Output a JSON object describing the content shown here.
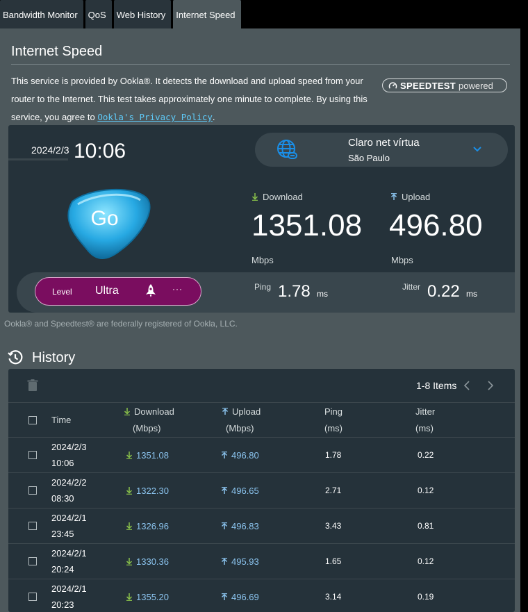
{
  "tabs": [
    {
      "label": "Bandwidth Monitor",
      "active": false
    },
    {
      "label": "QoS",
      "active": false
    },
    {
      "label": "Web History",
      "active": false
    },
    {
      "label": "Internet Speed",
      "active": true
    }
  ],
  "page": {
    "title": "Internet Speed",
    "description": "This service is provided by Ookla®. It detects the download and upload speed from your router to the Internet. This test takes approximately one minute to complete. By using this service, you agree to",
    "privacy_link": "Ookla's Privacy Policy",
    "description_end": ".",
    "logo_name": "SPEEDTEST",
    "logo_powered": "powered"
  },
  "result": {
    "date": "2024/2/3",
    "time": "10:06",
    "server_name": "Claro net vírtua",
    "server_location": "São Paulo",
    "go_label": "Go",
    "download_label": "Download",
    "upload_label": "Upload",
    "download_value": "1351.08",
    "upload_value": "496.80",
    "download_unit": "Mbps",
    "upload_unit": "Mbps",
    "level_label": "Level",
    "level_value": "Ultra",
    "more_label": "···",
    "ping_label": "Ping",
    "ping_value": "1.78",
    "ping_unit": "ms",
    "jitter_label": "Jitter",
    "jitter_value": "0.22",
    "jitter_unit": "ms"
  },
  "ookla_note": "Ookla® and Speedtest® are federally registered of Ookla, LLC.",
  "history": {
    "title": "History",
    "pager": "1-8 Items",
    "columns": {
      "time": "Time",
      "download": "Download",
      "download_unit": "(Mbps)",
      "upload": "Upload",
      "upload_unit": "(Mbps)",
      "ping": "Ping",
      "ping_unit": "(ms)",
      "jitter": "Jitter",
      "jitter_unit": "(ms)"
    },
    "rows": [
      {
        "date": "2024/2/3",
        "time": "10:06",
        "download": "1351.08",
        "upload": "496.80",
        "ping": "1.78",
        "jitter": "0.22"
      },
      {
        "date": "2024/2/2",
        "time": "08:30",
        "download": "1322.30",
        "upload": "496.65",
        "ping": "2.71",
        "jitter": "0.12"
      },
      {
        "date": "2024/2/1",
        "time": "23:45",
        "download": "1326.96",
        "upload": "496.83",
        "ping": "3.43",
        "jitter": "0.81"
      },
      {
        "date": "2024/2/1",
        "time": "20:24",
        "download": "1330.36",
        "upload": "495.93",
        "ping": "1.65",
        "jitter": "0.12"
      },
      {
        "date": "2024/2/1",
        "time": "20:23",
        "download": "1355.20",
        "upload": "496.69",
        "ping": "3.14",
        "jitter": "0.19"
      }
    ]
  },
  "colors": {
    "panel": "#4d585c",
    "card": "#25323a",
    "accent_link": "#5fcaf8",
    "level_pill": "#7a0d5f",
    "download_icon": "#8bc34a",
    "upload_icon": "#8cc5f0"
  }
}
